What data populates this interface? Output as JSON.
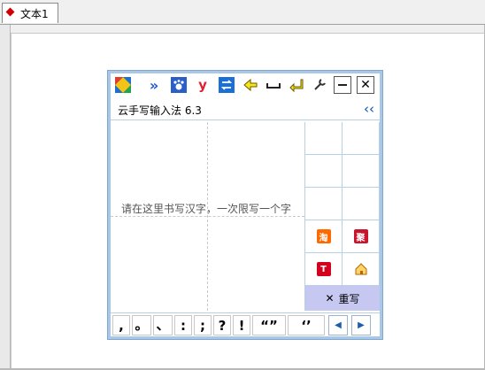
{
  "tab": {
    "label": "文本1"
  },
  "panel": {
    "title": "云手写输入法  6.3",
    "hint": "请在这里书写汉字，一次限写一个字",
    "rewrite": "重写",
    "punct": [
      ",",
      "。",
      "、",
      ":",
      ";",
      "?",
      "!",
      "“”",
      "‘’"
    ]
  },
  "icons": [
    "app-logo-icon",
    "forward-icon",
    "baidu-paw-icon",
    "youdao-icon",
    "switch-icon",
    "back-arrow-icon",
    "space-icon",
    "enter-icon",
    "wrench-icon",
    "minimize-icon",
    "close-icon"
  ],
  "colors": {
    "accent": "#c7c8f2",
    "border": "#a9c8e8"
  }
}
